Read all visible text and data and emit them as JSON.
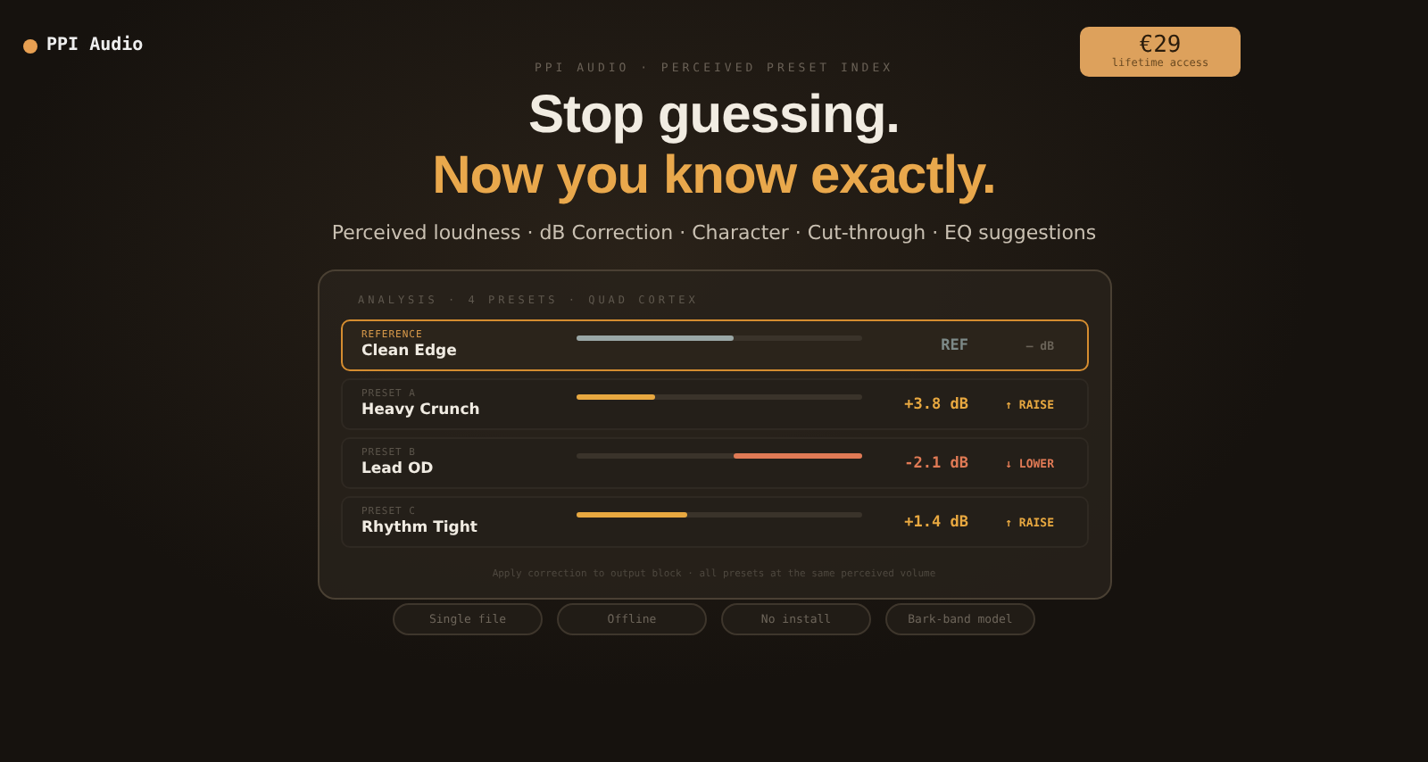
{
  "brand": {
    "name": "PPI Audio"
  },
  "price": {
    "amount": "€29",
    "caption": "lifetime access"
  },
  "eyebrow": "PPI AUDIO · PERCEIVED PRESET INDEX",
  "headline": [
    "Stop guessing.",
    "Now you know exactly."
  ],
  "subtitle": "Perceived loudness · dB Correction · Character · Cut-through · EQ suggestions",
  "panel": {
    "header": "ANALYSIS · 4 PRESETS · QUAD CORTEX",
    "rows": [
      {
        "kind": "reference",
        "selected": true,
        "tag": "REFERENCE",
        "name": "Clean Edge",
        "level": 0.55,
        "value": "REF",
        "action": "— dB"
      },
      {
        "kind": "raise",
        "selected": false,
        "tag": "PRESET A",
        "name": "Heavy Crunch",
        "level": 0.28,
        "value": "+3.8 dB",
        "action": "↑ RAISE"
      },
      {
        "kind": "lower",
        "selected": false,
        "tag": "PRESET B",
        "name": "Lead OD",
        "level": 0.45,
        "value": "-2.1 dB",
        "action": "↓ LOWER"
      },
      {
        "kind": "raise",
        "selected": false,
        "tag": "PRESET C",
        "name": "Rhythm Tight",
        "level": 0.39,
        "value": "+1.4 dB",
        "action": "↑ RAISE"
      }
    ],
    "footnote": "Apply correction to output block · all presets at the same perceived volume"
  },
  "features": [
    "Single file",
    "Offline",
    "No install",
    "Bark-band model"
  ]
}
